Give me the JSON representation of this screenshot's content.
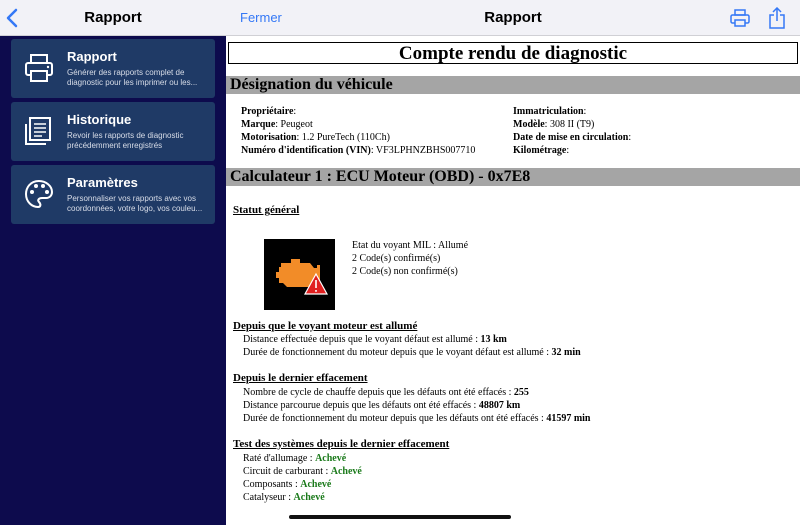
{
  "sidebar": {
    "title": "Rapport",
    "cards": [
      {
        "title": "Rapport",
        "description": "Générer des rapports complet de diagnostic pour les imprimer ou les...",
        "icon": "printer-icon"
      },
      {
        "title": "Historique",
        "description": "Revoir les rapports de diagnostic précédemment enregistrés",
        "icon": "documents-icon"
      },
      {
        "title": "Paramètres",
        "description": "Personnaliser vos rapports avec vos coordonnées, votre logo, vos couleu...",
        "icon": "palette-icon"
      }
    ]
  },
  "topbar": {
    "close_label": "Fermer",
    "title": "Rapport"
  },
  "report": {
    "title": "Compte rendu de diagnostic",
    "vehicle_section": "Désignation du véhicule",
    "left_fields": [
      {
        "label": "Propriétaire",
        "value": ""
      },
      {
        "label": "Marque",
        "value": "Peugeot"
      },
      {
        "label": "Motorisation",
        "value": "1.2 PureTech (110Ch)"
      },
      {
        "label": "Numéro d'identification (VIN)",
        "value": "VF3LPHNZBHS007710"
      }
    ],
    "right_fields": [
      {
        "label": "Immatriculation",
        "value": ""
      },
      {
        "label": "Modèle",
        "value": "308 II (T9)"
      },
      {
        "label": "Date de mise en circulation",
        "value": ""
      },
      {
        "label": "Kilométrage",
        "value": ""
      }
    ],
    "ecu_section": "Calculateur 1 : ECU Moteur (OBD) - 0x7E8",
    "status_heading": "Statut général",
    "status_lines": [
      "Etat du voyant MIL : Allumé",
      "2 Code(s) confirmé(s)",
      "2 Code(s) non confirmé(s)"
    ],
    "mil_heading": "Depuis que le voyant moteur est allumé",
    "mil_lines": [
      {
        "text": "Distance effectuée depuis que le voyant défaut est allumé : ",
        "value": "13 km"
      },
      {
        "text": "Durée de fonctionnement du moteur depuis que le voyant défaut est allumé : ",
        "value": "32 min"
      }
    ],
    "clear_heading": "Depuis le dernier effacement",
    "clear_lines": [
      {
        "text": "Nombre de cycle de chauffe depuis que les défauts ont été effacés : ",
        "value": "255"
      },
      {
        "text": "Distance parcourue depuis que les défauts ont été effacés : ",
        "value": "48807 km"
      },
      {
        "text": "Durée de fonctionnement du moteur depuis que les défauts ont été effacés : ",
        "value": "41597 min"
      }
    ],
    "test_heading": "Test des systèmes depuis le dernier effacement",
    "test_lines": [
      {
        "text": "Raté d'allumage : ",
        "value": "Achevé"
      },
      {
        "text": "Circuit de carburant : ",
        "value": "Achevé"
      },
      {
        "text": "Composants : ",
        "value": "Achevé"
      },
      {
        "text": "Catalyseur : ",
        "value": "Achevé"
      }
    ]
  },
  "colors": {
    "accent": "#3478f6",
    "sidebar_bg": "#0d0b4d",
    "card_bg": "#1f3a66",
    "ok": "#1a7a1a",
    "engine_orange": "#f28c28",
    "warning_red": "#e02020"
  }
}
